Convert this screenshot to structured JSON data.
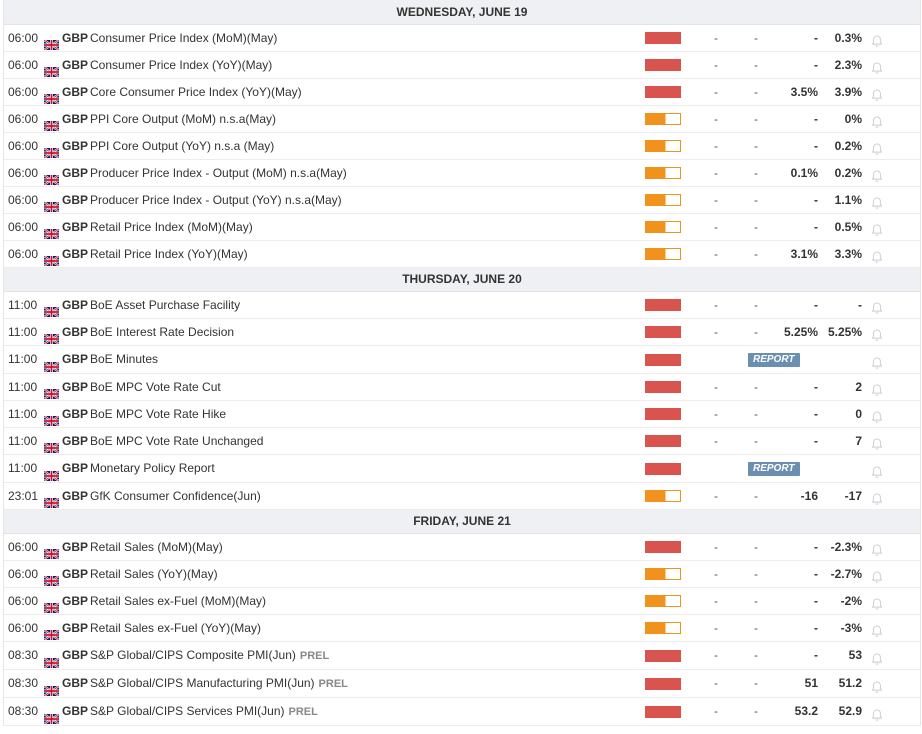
{
  "days": [
    {
      "label": "WEDNESDAY, JUNE 19",
      "events": [
        {
          "time": "06:00",
          "currency": "GBP",
          "name": "Consumer Price Index (MoM)(May)",
          "prel": "",
          "impact": "high",
          "actual": "-",
          "deviation": "-",
          "consensus": "-",
          "previous": "0.3%"
        },
        {
          "time": "06:00",
          "currency": "GBP",
          "name": "Consumer Price Index (YoY)(May)",
          "prel": "",
          "impact": "high",
          "actual": "-",
          "deviation": "-",
          "consensus": "-",
          "previous": "2.3%"
        },
        {
          "time": "06:00",
          "currency": "GBP",
          "name": "Core Consumer Price Index (YoY)(May)",
          "prel": "",
          "impact": "high",
          "actual": "-",
          "deviation": "-",
          "consensus": "3.5%",
          "previous": "3.9%"
        },
        {
          "time": "06:00",
          "currency": "GBP",
          "name": "PPI Core Output (MoM) n.s.a(May)",
          "prel": "",
          "impact": "medium",
          "actual": "-",
          "deviation": "-",
          "consensus": "-",
          "previous": "0%"
        },
        {
          "time": "06:00",
          "currency": "GBP",
          "name": "PPI Core Output (YoY) n.s.a (May)",
          "prel": "",
          "impact": "medium",
          "actual": "-",
          "deviation": "-",
          "consensus": "-",
          "previous": "0.2%"
        },
        {
          "time": "06:00",
          "currency": "GBP",
          "name": "Producer Price Index - Output (MoM) n.s.a(May)",
          "prel": "",
          "impact": "medium",
          "actual": "-",
          "deviation": "-",
          "consensus": "0.1%",
          "previous": "0.2%"
        },
        {
          "time": "06:00",
          "currency": "GBP",
          "name": "Producer Price Index - Output (YoY) n.s.a(May)",
          "prel": "",
          "impact": "medium",
          "actual": "-",
          "deviation": "-",
          "consensus": "-",
          "previous": "1.1%"
        },
        {
          "time": "06:00",
          "currency": "GBP",
          "name": "Retail Price Index (MoM)(May)",
          "prel": "",
          "impact": "medium",
          "actual": "-",
          "deviation": "-",
          "consensus": "-",
          "previous": "0.5%"
        },
        {
          "time": "06:00",
          "currency": "GBP",
          "name": "Retail Price Index (YoY)(May)",
          "prel": "",
          "impact": "medium",
          "actual": "-",
          "deviation": "-",
          "consensus": "3.1%",
          "previous": "3.3%"
        }
      ]
    },
    {
      "label": "THURSDAY, JUNE 20",
      "events": [
        {
          "time": "11:00",
          "currency": "GBP",
          "name": "BoE Asset Purchase Facility",
          "prel": "",
          "impact": "high",
          "actual": "-",
          "deviation": "-",
          "consensus": "-",
          "previous": "-"
        },
        {
          "time": "11:00",
          "currency": "GBP",
          "name": "BoE Interest Rate Decision",
          "prel": "",
          "impact": "high",
          "actual": "-",
          "deviation": "-",
          "consensus": "5.25%",
          "previous": "5.25%"
        },
        {
          "time": "11:00",
          "currency": "GBP",
          "name": "BoE Minutes",
          "prel": "",
          "impact": "high",
          "report": "REPORT",
          "tall": true
        },
        {
          "time": "11:00",
          "currency": "GBP",
          "name": "BoE MPC Vote Rate Cut",
          "prel": "",
          "impact": "high",
          "actual": "-",
          "deviation": "-",
          "consensus": "-",
          "previous": "2"
        },
        {
          "time": "11:00",
          "currency": "GBP",
          "name": "BoE MPC Vote Rate Hike",
          "prel": "",
          "impact": "high",
          "actual": "-",
          "deviation": "-",
          "consensus": "-",
          "previous": "0"
        },
        {
          "time": "11:00",
          "currency": "GBP",
          "name": "BoE MPC Vote Rate Unchanged",
          "prel": "",
          "impact": "high",
          "actual": "-",
          "deviation": "-",
          "consensus": "-",
          "previous": "7"
        },
        {
          "time": "11:00",
          "currency": "GBP",
          "name": "Monetary Policy Report",
          "prel": "",
          "impact": "high",
          "report": "REPORT",
          "tall": true
        },
        {
          "time": "23:01",
          "currency": "GBP",
          "name": "GfK Consumer Confidence(Jun)",
          "prel": "",
          "impact": "medium",
          "actual": "-",
          "deviation": "-",
          "consensus": "-16",
          "previous": "-17"
        }
      ]
    },
    {
      "label": "FRIDAY, JUNE 21",
      "events": [
        {
          "time": "06:00",
          "currency": "GBP",
          "name": "Retail Sales (MoM)(May)",
          "prel": "",
          "impact": "high",
          "actual": "-",
          "deviation": "-",
          "consensus": "-",
          "previous": "-2.3%"
        },
        {
          "time": "06:00",
          "currency": "GBP",
          "name": "Retail Sales (YoY)(May)",
          "prel": "",
          "impact": "medium",
          "actual": "-",
          "deviation": "-",
          "consensus": "-",
          "previous": "-2.7%"
        },
        {
          "time": "06:00",
          "currency": "GBP",
          "name": "Retail Sales ex-Fuel (MoM)(May)",
          "prel": "",
          "impact": "medium",
          "actual": "-",
          "deviation": "-",
          "consensus": "-",
          "previous": "-2%"
        },
        {
          "time": "06:00",
          "currency": "GBP",
          "name": "Retail Sales ex-Fuel (YoY)(May)",
          "prel": "",
          "impact": "medium",
          "actual": "-",
          "deviation": "-",
          "consensus": "-",
          "previous": "-3%"
        },
        {
          "time": "08:30",
          "currency": "GBP",
          "name": "S&P Global/CIPS Composite PMI(Jun)",
          "prel": "PREL",
          "impact": "high",
          "actual": "-",
          "deviation": "-",
          "consensus": "-",
          "previous": "53",
          "tall": true
        },
        {
          "time": "08:30",
          "currency": "GBP",
          "name": "S&P Global/CIPS Manufacturing PMI(Jun)",
          "prel": "PREL",
          "impact": "high",
          "actual": "-",
          "deviation": "-",
          "consensus": "51",
          "previous": "51.2",
          "tall": true
        },
        {
          "time": "08:30",
          "currency": "GBP",
          "name": "S&P Global/CIPS Services PMI(Jun)",
          "prel": "PREL",
          "impact": "high",
          "actual": "-",
          "deviation": "-",
          "consensus": "53.2",
          "previous": "52.9",
          "tall": true
        }
      ]
    }
  ],
  "colors": {
    "high_impact": "#d9534f",
    "medium_impact": "#f0921c",
    "report_badge": "#6a8fb0",
    "header_bg": "#eef0f3"
  },
  "icons": {
    "flag": "uk-flag-icon",
    "alert": "bell-icon"
  }
}
